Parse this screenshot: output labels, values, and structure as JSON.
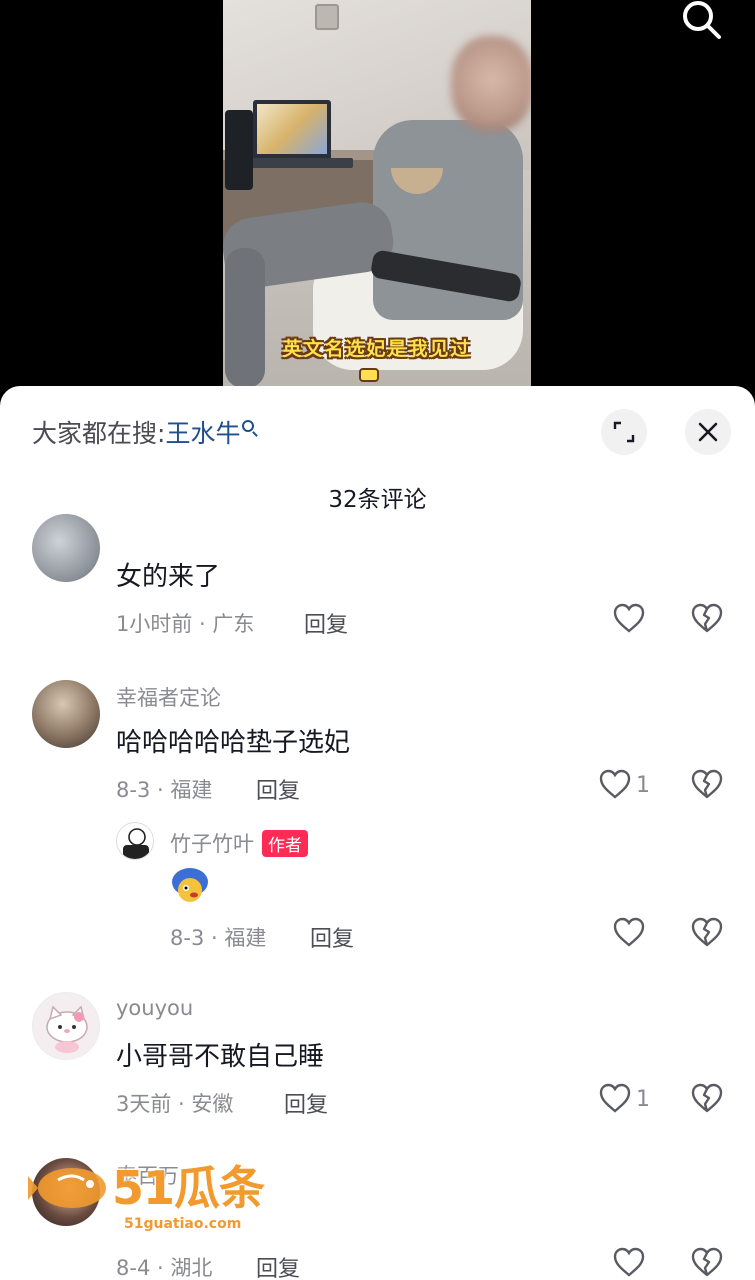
{
  "video": {
    "caption": "英文名选妃是我见过"
  },
  "sheet": {
    "hot_search_prefix": "大家都在搜:",
    "hot_search_keyword": "王水牛",
    "comment_count_title": "32条评论"
  },
  "comments": [
    {
      "user": "",
      "text": "女的来了",
      "meta": "1小时前 · 广东",
      "reply_label": "回复",
      "likes": ""
    },
    {
      "user": "幸福者定论",
      "text": "哈哈哈哈哈垫子选妃",
      "meta": "8-3 · 福建",
      "reply_label": "回复",
      "likes": "1",
      "replies": [
        {
          "user": "竹子竹叶",
          "badge": "作者",
          "meta": "8-3 · 福建",
          "reply_label": "回复",
          "likes": ""
        }
      ]
    },
    {
      "user": "youyou",
      "text": "小哥哥不敢自己睡",
      "meta": "3天前 · 安徽",
      "reply_label": "回复",
      "likes": "1"
    },
    {
      "user": "泰百万",
      "text": "",
      "meta": "8-4 · 湖北",
      "reply_label": "回复",
      "likes": ""
    }
  ],
  "watermark": {
    "brand": "51瓜条",
    "domain": "51guatiao.com"
  },
  "colors": {
    "author_badge": "#fe2c55",
    "hot_search_keyword": "#1f4f8c",
    "caption": "#ffe14d"
  },
  "icons": [
    "search-icon",
    "expand-icon",
    "close-icon",
    "heart-icon",
    "broken-heart-icon"
  ]
}
